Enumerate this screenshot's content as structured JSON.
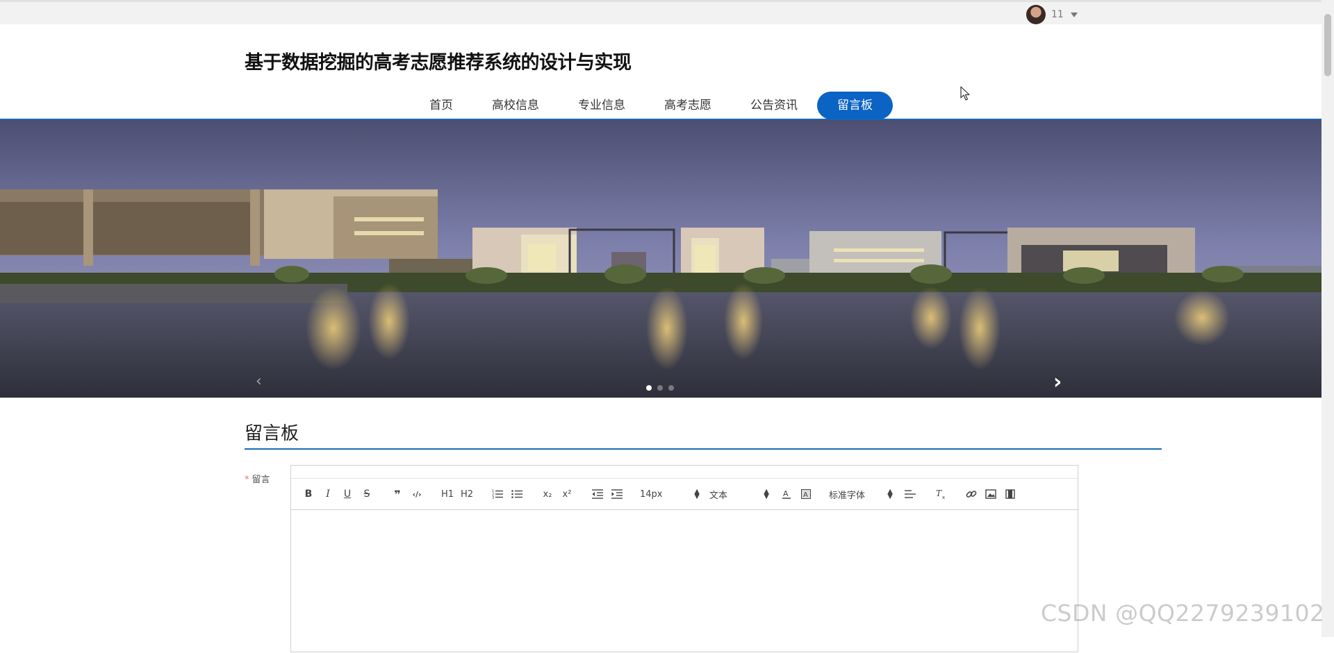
{
  "user": {
    "name": "11"
  },
  "site": {
    "title": "基于数据挖掘的高考志愿推荐系统的设计与实现"
  },
  "nav": {
    "items": [
      {
        "label": "首页"
      },
      {
        "label": "高校信息"
      },
      {
        "label": "专业信息"
      },
      {
        "label": "高考志愿"
      },
      {
        "label": "公告资讯"
      },
      {
        "label": "留言板"
      }
    ],
    "active_index": 5
  },
  "banner": {
    "slide_count": 3,
    "active_slide": 0,
    "next_arrow": "›",
    "prev_arrow": "‹"
  },
  "section": {
    "title": "留言板"
  },
  "form": {
    "label": "留言",
    "required_mark": "*"
  },
  "editor": {
    "toolbar": {
      "bold": "B",
      "italic": "I",
      "underline": "U",
      "strike": "S",
      "quote": "❞",
      "code": "‹/›",
      "h1": "H1",
      "h2": "H2",
      "sub": "x₂",
      "sup": "x²",
      "size_value": "14px",
      "format_value": "文本",
      "font_value": "标准字体"
    }
  },
  "watermark": {
    "text": "CSDN @QQ2279239102"
  },
  "colors": {
    "accent": "#0b63c4",
    "line": "#1767b4"
  }
}
